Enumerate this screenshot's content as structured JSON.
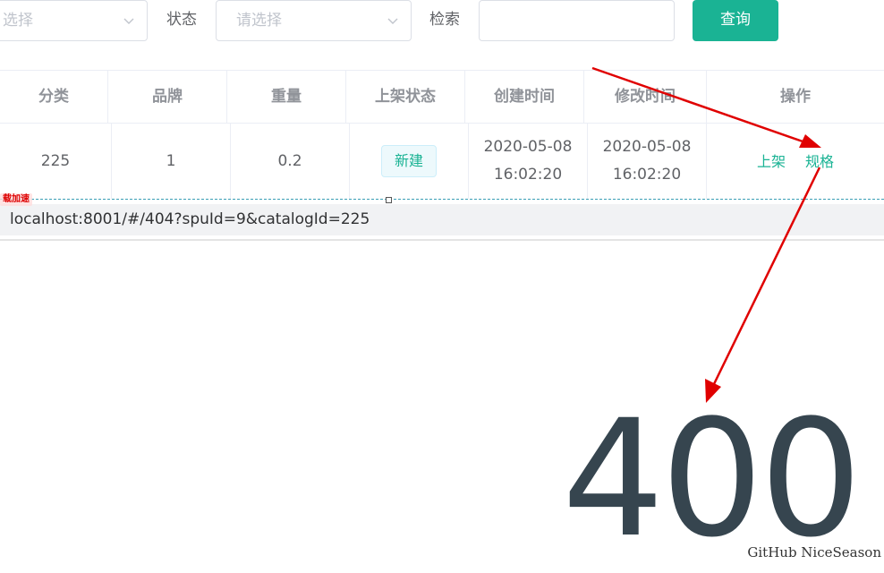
{
  "filters": {
    "first_select_placeholder": "选择",
    "status_label": "状态",
    "status_placeholder": "请选择",
    "search_label": "检索",
    "search_value": "",
    "query_button": "查询"
  },
  "table": {
    "columns": [
      "分类",
      "品牌",
      "重量",
      "上架状态",
      "创建时间",
      "修改时间",
      "操作"
    ],
    "row": {
      "category": "225",
      "brand": "1",
      "weight": "0.2",
      "status_tag": "新建",
      "created_date": "2020-05-08",
      "created_time": "16:02:20",
      "modified_date": "2020-05-08",
      "modified_time": "16:02:20",
      "actions": [
        "上架",
        "规格"
      ]
    }
  },
  "status_bar": {
    "badge": "载加速",
    "url": "localhost:8001/#/404?spuId=9&catalogId=225"
  },
  "error_page": {
    "code": "400"
  },
  "watermark": "GitHub NiceSeason",
  "colors": {
    "accent": "#1ab394",
    "annotation_arrow": "#e00000",
    "error_code": "#36454f"
  }
}
